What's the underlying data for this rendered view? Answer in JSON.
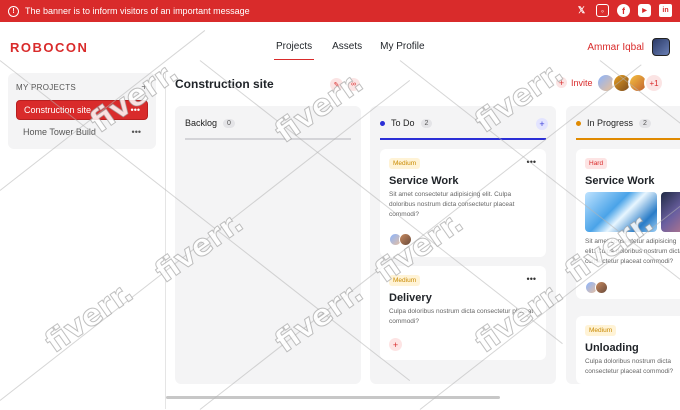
{
  "banner": {
    "message": "The banner is to inform visitors of an important message",
    "icons": [
      "x-icon",
      "instagram-icon",
      "facebook-icon",
      "youtube-icon",
      "linkedin-icon"
    ]
  },
  "nav": {
    "logo": "ROBOCON",
    "links": [
      "Projects",
      "Assets",
      "My Profile"
    ],
    "active": "Projects",
    "user_name": "Ammar Iqbal"
  },
  "sidebar": {
    "heading": "MY PROJECTS",
    "items": [
      {
        "label": "Construction site",
        "selected": true
      },
      {
        "label": "Home Tower Build",
        "selected": false
      }
    ]
  },
  "board": {
    "title": "Construction site",
    "invite_label": "Invite",
    "extra_members": "+1",
    "columns": [
      {
        "name": "Backlog",
        "count": "0",
        "accent": "#9ca3af",
        "cards": []
      },
      {
        "name": "To Do",
        "count": "2",
        "accent": "#2b2fd6",
        "cards": [
          {
            "badge": "Medium",
            "title": "Service Work",
            "body": "Sit amet consectetur adipisicing elit. Culpa doloribus nostrum dicta consectetur placeat commodi?"
          },
          {
            "badge": "Medium",
            "title": "Delivery",
            "body": "Culpa doloribus nostrum dicta consectetur placeat commodi?"
          }
        ]
      },
      {
        "name": "In Progress",
        "count": "2",
        "accent": "#e08a00",
        "cards": [
          {
            "badge": "Hard",
            "title": "Service Work",
            "body": "Sit amet consectetur adipisicing elit. Culpa doloribus nostrum dicta consectetur placeat commodi?"
          },
          {
            "badge": "Medium",
            "title": "Unloading",
            "body": "Culpa doloribus nostrum dicta consectetur placeat commodi?"
          }
        ]
      }
    ]
  },
  "watermark": "fiverr."
}
